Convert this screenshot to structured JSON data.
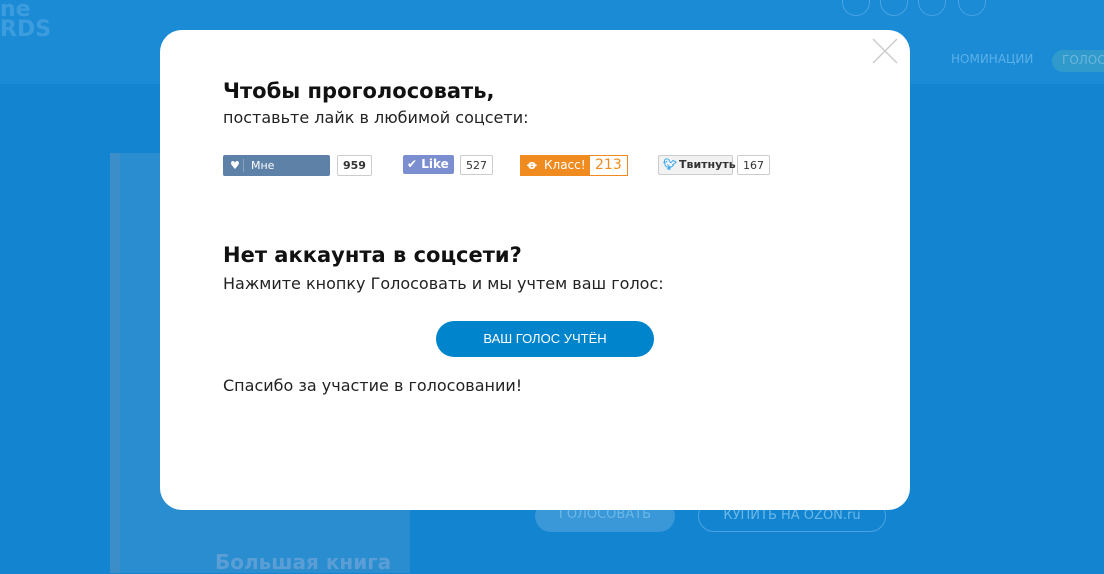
{
  "background": {
    "logo": "ne\nRDS",
    "nav_nominations": "НОМИНАЦИИ",
    "nav_vote": "ГОЛОС",
    "vote_button": "ГОЛОСОВАТЬ",
    "buy_button": "КУПИТЬ НА OZON.ru",
    "book_title": "Большая книга"
  },
  "modal": {
    "title1": "Чтобы проголосовать,",
    "subtitle1": "поставьте лайк в любимой соцсети:",
    "social": {
      "vk": {
        "label": "Мне нравится",
        "count": "959",
        "color": "#5e81a8"
      },
      "fb": {
        "label": "Like",
        "count": "527",
        "color": "#7b8ed0"
      },
      "ok": {
        "label": "Класс!",
        "count": "213",
        "color": "#f08b1f"
      },
      "tw": {
        "label": "Твитнуть",
        "count": "167"
      }
    },
    "title2": "Нет аккаунта в соцсети?",
    "subtitle2": "Нажмите кнопку Голосовать и мы учтем ваш голос:",
    "vote_button": "ВАШ ГОЛОС УЧТЁН",
    "thanks": "Спасибо за участие в голосовании!"
  }
}
